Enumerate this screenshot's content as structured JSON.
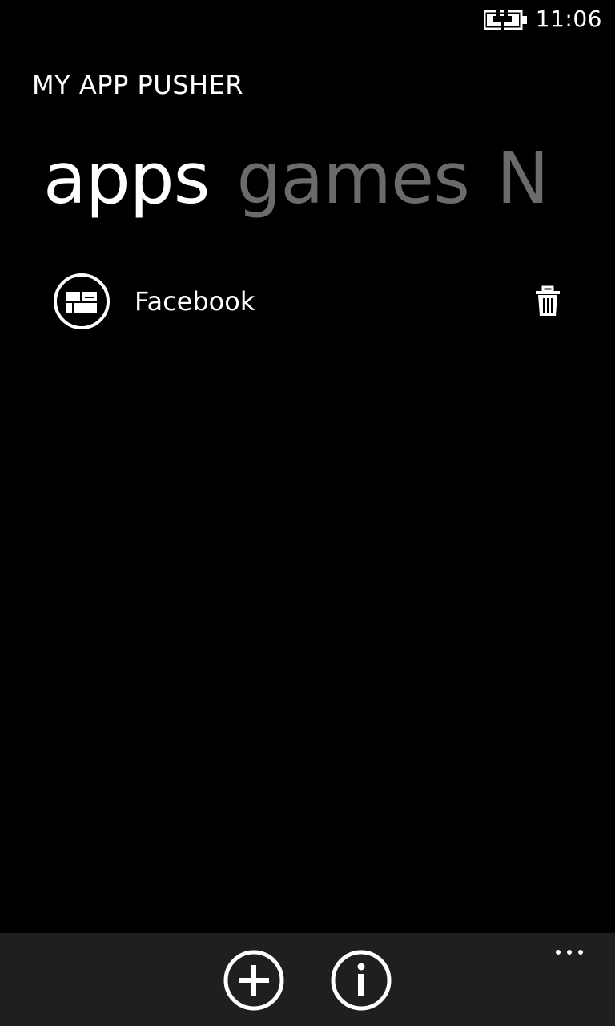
{
  "status_bar": {
    "time": "11:06",
    "battery_icon": "battery-charging-icon"
  },
  "app": {
    "title": "MY APP PUSHER"
  },
  "pivot": {
    "tabs": [
      {
        "label": "apps",
        "active": true
      },
      {
        "label": "games",
        "active": false
      },
      {
        "label": "N",
        "active": false
      }
    ]
  },
  "list": {
    "items": [
      {
        "label": "Facebook",
        "icon": "app-tile-icon",
        "action_icon": "trash-icon"
      }
    ]
  },
  "app_bar": {
    "buttons": [
      {
        "icon": "add-icon"
      },
      {
        "icon": "info-icon"
      }
    ],
    "more_icon": "ellipsis-icon"
  },
  "colors": {
    "background": "#000000",
    "foreground": "#ffffff",
    "inactive_tab": "#6b6b6b",
    "app_bar": "#1f1f1f"
  }
}
